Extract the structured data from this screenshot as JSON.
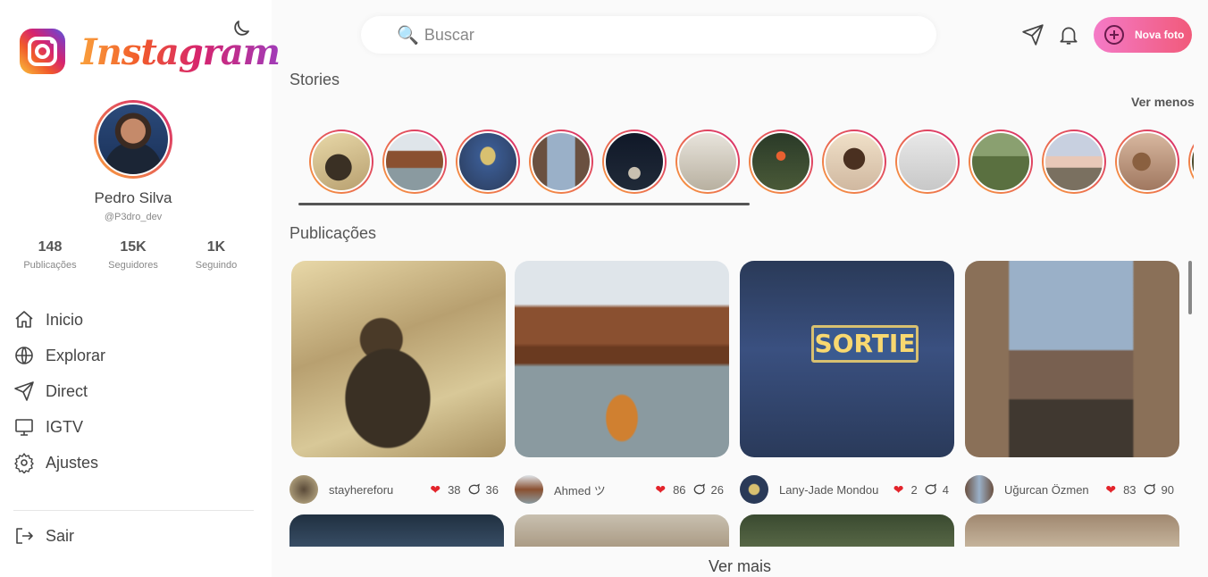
{
  "brand": {
    "name": "Instagram"
  },
  "profile": {
    "name": "Pedro Silva",
    "handle": "@P3dro_dev"
  },
  "stats": [
    {
      "value": "148",
      "label": "Publicações"
    },
    {
      "value": "15K",
      "label": "Seguidores"
    },
    {
      "value": "1K",
      "label": "Seguindo"
    }
  ],
  "nav": [
    {
      "label": "Inicio",
      "icon": "home-icon"
    },
    {
      "label": "Explorar",
      "icon": "globe-icon"
    },
    {
      "label": "Direct",
      "icon": "send-icon"
    },
    {
      "label": "IGTV",
      "icon": "tv-icon"
    },
    {
      "label": "Ajustes",
      "icon": "gear-icon"
    }
  ],
  "logout": {
    "label": "Sair",
    "icon": "logout-icon"
  },
  "search": {
    "placeholder": "Buscar"
  },
  "header": {
    "new_photo_label": "Nova foto"
  },
  "stories": {
    "title": "Stories",
    "toggle_label": "Ver menos",
    "count": 13
  },
  "feed": {
    "title": "Publicações",
    "posts": [
      {
        "user": "stayhereforu",
        "likes": "38",
        "comments": "36"
      },
      {
        "user": "Ahmed ツ",
        "likes": "86",
        "comments": "26"
      },
      {
        "user": "Lany-Jade Mondou",
        "likes": "2",
        "comments": "4"
      },
      {
        "user": "Uğurcan Özmen",
        "likes": "83",
        "comments": "90"
      }
    ],
    "sign_text": "SORTIE",
    "more_label": "Ver mais"
  },
  "colors": {
    "accent_start": "#f47ac7",
    "accent_end": "#f15a7a",
    "heart": "#e3242b"
  }
}
